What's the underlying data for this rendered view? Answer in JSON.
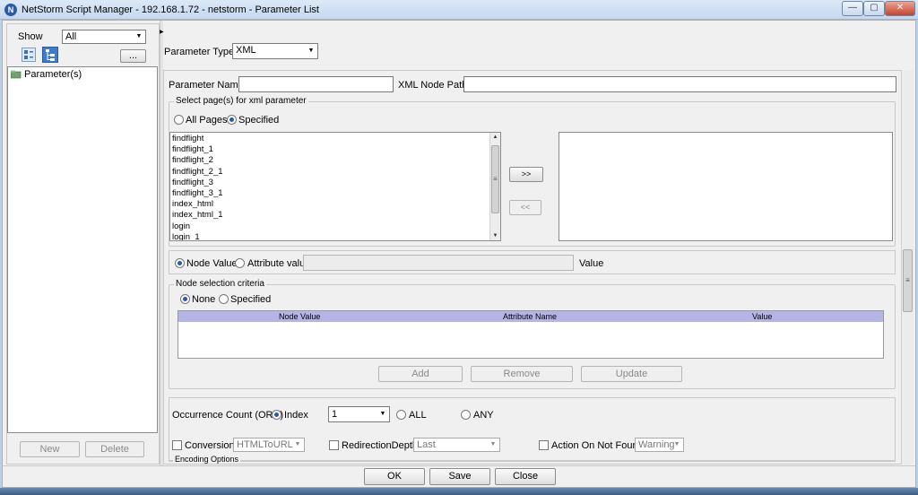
{
  "window": {
    "title": "NetStorm Script Manager - 192.168.1.72 - netstorm - Parameter List",
    "app_icon_glyph": "N",
    "controls": [
      "—",
      "▢",
      "✕"
    ]
  },
  "left": {
    "show_label": "Show",
    "show_value": "All",
    "more_button": "...",
    "tree_root": "Parameter(s)",
    "new_button": "New",
    "delete_button": "Delete"
  },
  "param_type": {
    "label": "Parameter Type :",
    "value": "XML"
  },
  "top_fields": {
    "name_label": "Parameter Name",
    "name_value": "",
    "xml_path_label": "XML Node Path",
    "xml_path_value": ""
  },
  "pages_group": {
    "title": "Select page(s) for xml parameter",
    "all_pages_label": "All Pages",
    "specified_label": "Specified",
    "selected_mode": "specified",
    "pages": [
      "findflight",
      "findflight_1",
      "findflight_2",
      "findflight_2_1",
      "findflight_3",
      "findflight_3_1",
      "index_html",
      "index_html_1",
      "login",
      "login_1"
    ],
    "add_button": ">>",
    "remove_button": "<<"
  },
  "value_row": {
    "node_value_label": "Node Value",
    "attribute_value_label": "Attribute value",
    "attribute_input": "",
    "value_label": "Value",
    "selected": "node"
  },
  "node_criteria": {
    "title": "Node selection criteria",
    "none_label": "None",
    "specified_label": "Specified",
    "columns": [
      "Node Value",
      "Attribute Name",
      "Value"
    ],
    "add_button": "Add",
    "remove_button": "Remove",
    "update_button": "Update"
  },
  "occurrence": {
    "label": "Occurrence Count (ORD)",
    "index_label": "Index",
    "index_value": "1",
    "all_label": "ALL",
    "any_label": "ANY"
  },
  "options": {
    "conversion_label": "Conversion",
    "conversion_value": "HTMLToURL",
    "redirection_label": "RedirectionDepth",
    "redirection_value": "Last",
    "action_label": "Action On Not Found",
    "action_value": "Warning",
    "encoding_label": "Encoding Options"
  },
  "footer": {
    "ok": "OK",
    "save": "Save",
    "close": "Close"
  },
  "colors": {
    "title_bar": "#c4d8ee",
    "table_header": "#b6b3e6",
    "accent": "#2a5aa8"
  }
}
